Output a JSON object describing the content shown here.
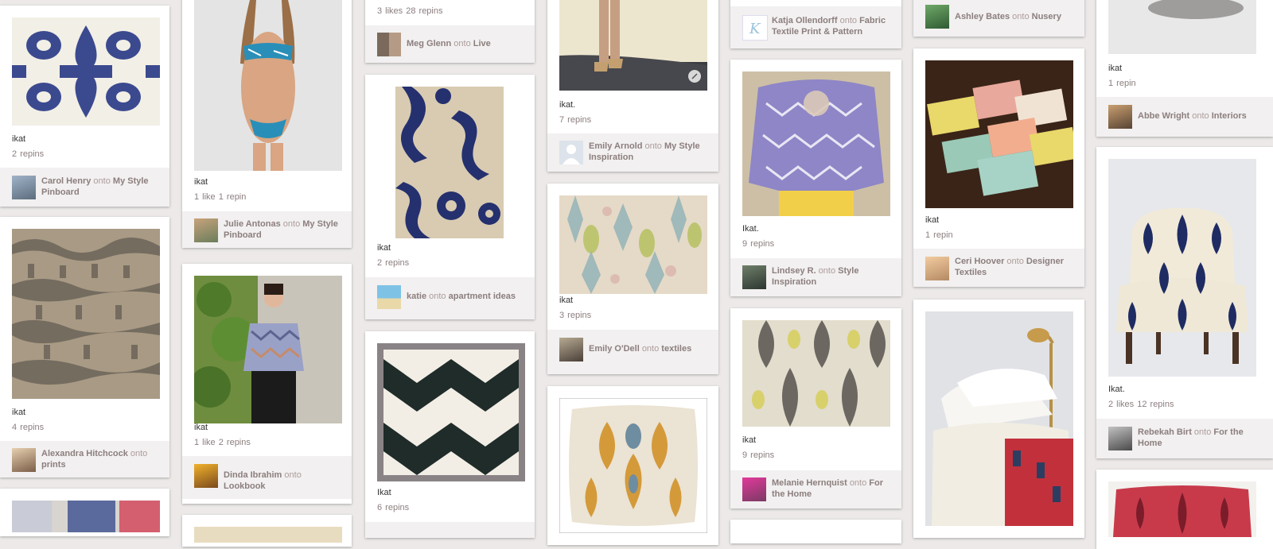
{
  "pins": {
    "carol": {
      "desc": "ikat",
      "stats": "2 repins",
      "user": "Carol Henry",
      "onto": "onto",
      "board": "My Style Pinboard"
    },
    "alexandra": {
      "desc": "ikat",
      "stats": "4 repins",
      "user": "Alexandra Hitchcock",
      "onto": "onto",
      "board": "prints"
    },
    "julie": {
      "desc": "ikat",
      "stats": "1 like  1 repin",
      "user": "Julie Antonas",
      "onto": "onto",
      "board": "My Style Pinboard"
    },
    "dinda": {
      "desc": "ikat",
      "stats": "1 like  2 repins",
      "user": "Dinda Ibrahim",
      "onto": "onto",
      "board": "Lookbook"
    },
    "meg": {
      "stats": "3 likes  28 repins",
      "user": "Meg Glenn",
      "onto": "onto",
      "board": "Live"
    },
    "katie": {
      "desc": "ikat",
      "stats": "2 repins",
      "user": "katie",
      "onto": "onto",
      "board": "apartment ideas"
    },
    "chevron": {
      "desc": "Ikat",
      "stats": "6 repins"
    },
    "emily_a": {
      "desc": "ikat.",
      "stats": "7 repins",
      "user": "Emily Arnold",
      "onto": "onto",
      "board": "My Style Inspiration"
    },
    "emily_o": {
      "desc": "ikat",
      "stats": "3 repins",
      "user": "Emily O'Dell",
      "onto": "onto",
      "board": "textiles"
    },
    "katja": {
      "user": "Katja Ollendorff",
      "onto": "onto",
      "board": "Fabric Textile Print & Pattern"
    },
    "lindsey": {
      "desc": "Ikat.",
      "stats": "9 repins",
      "user": "Lindsey R.",
      "onto": "onto",
      "board": "Style Inspiration"
    },
    "melanie": {
      "desc": "ikat",
      "stats": "9 repins",
      "user": "Melanie Hernquist",
      "onto": "onto",
      "board": "For the Home"
    },
    "ashley": {
      "user": "Ashley Bates",
      "onto": "onto",
      "board": "Nusery"
    },
    "ceri": {
      "desc": "ikat",
      "stats": "1 repin",
      "user": "Ceri Hoover",
      "onto": "onto",
      "board": "Designer Textiles"
    },
    "abbe": {
      "desc": "ikat",
      "stats": "1 repin",
      "user": "Abbe Wright",
      "onto": "onto",
      "board": "Interiors"
    },
    "rebekah": {
      "desc": "Ikat.",
      "stats": "2 likes  12 repins",
      "user": "Rebekah Birt",
      "onto": "onto",
      "board": "For the Home"
    }
  },
  "colors": {
    "background": "#ece9e8",
    "attribution_bg": "#f2f0f0",
    "muted_text": "#8c7e7e",
    "ikat_navy": "#2f3f86"
  }
}
